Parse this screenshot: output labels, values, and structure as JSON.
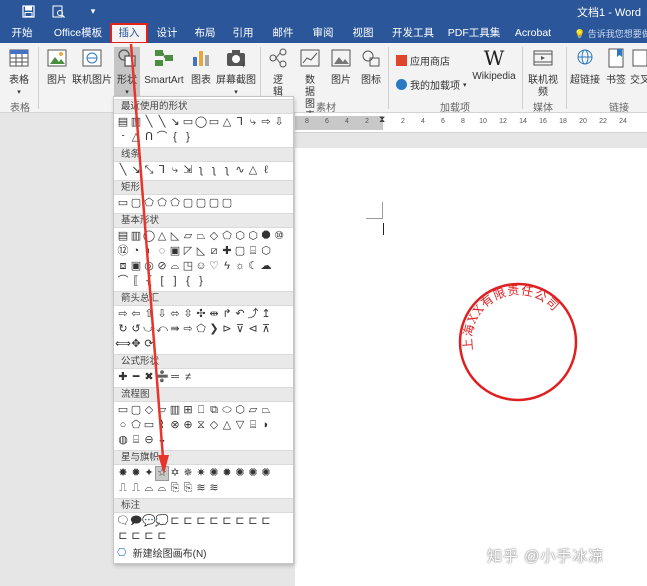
{
  "titlebar": {
    "title": "文档1 - Word"
  },
  "tabs": [
    {
      "label": "开始"
    },
    {
      "label": "Office模板"
    },
    {
      "label": "插入"
    },
    {
      "label": "设计"
    },
    {
      "label": "布局"
    },
    {
      "label": "引用"
    },
    {
      "label": "邮件"
    },
    {
      "label": "审阅"
    },
    {
      "label": "视图"
    },
    {
      "label": "开发工具"
    },
    {
      "label": "PDF工具集"
    },
    {
      "label": "Acrobat"
    }
  ],
  "tell_me": "告诉我您想要做",
  "ribbon": {
    "table": "表格",
    "picture": "图片",
    "online_picture": "联机图片",
    "shapes": "形状",
    "smartart": "SmartArt",
    "chart": "图表",
    "screenshot": "屏幕截图",
    "logic_chart": "逻辑图表",
    "data_chart": "数据图表",
    "picture2": "图片",
    "icon": "图标",
    "store": "应用商店",
    "my_addins": "我的加载项",
    "wikipedia": "Wikipedia",
    "online_video": "联机视频",
    "hyperlink": "超链接",
    "bookmark": "书签",
    "crossref": "交叉",
    "groups": {
      "tables": "表格",
      "material": "素材",
      "addins": "加载项",
      "media": "媒体",
      "links": "链接"
    }
  },
  "ruler": {
    "ticks": [
      "8",
      "6",
      "4",
      "2",
      "",
      "2",
      "4",
      "6",
      "8",
      "10",
      "12",
      "14",
      "16",
      "18",
      "20",
      "22",
      "24"
    ]
  },
  "dropdown": {
    "sections": [
      {
        "label": "最近使用的形状"
      },
      {
        "label": "线条"
      },
      {
        "label": "矩形"
      },
      {
        "label": "基本形状"
      },
      {
        "label": "箭头总汇"
      },
      {
        "label": "公式形状"
      },
      {
        "label": "流程图"
      },
      {
        "label": "星与旗帜"
      },
      {
        "label": "标注"
      }
    ],
    "new_canvas": "新建绘图画布(N)"
  },
  "seal": {
    "text": "上海XX有限责任公司",
    "color": "#e02020"
  },
  "watermark": "知乎 @小手冰凉",
  "colors": {
    "word_blue": "#2b579a",
    "highlight_red": "#e0221c"
  }
}
